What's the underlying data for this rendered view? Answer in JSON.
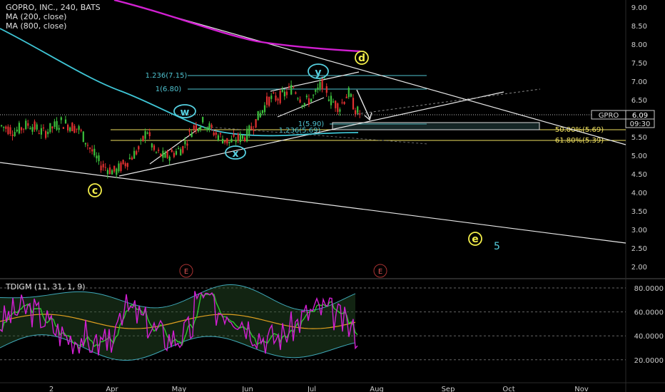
{
  "symbol_header": "GOPRO, INC., 240, BATS",
  "indicators": [
    "MA (200, close)",
    "MA (800, close)"
  ],
  "oscillator_label": "TDIGM (11, 31, 1, 9)",
  "price_axis": [
    "9.00",
    "8.50",
    "8.00",
    "7.50",
    "7.00",
    "6.50",
    "6.00",
    "5.50",
    "5.00",
    "4.50",
    "4.00",
    "3.50",
    "3.00",
    "2.50",
    "2.00"
  ],
  "osc_axis": [
    "80.0000",
    "60.0000",
    "40.0000",
    "20.0000"
  ],
  "time_axis": [
    "2",
    "Apr",
    "May",
    "Jun",
    "Jul",
    "Aug",
    "Sep",
    "Oct",
    "Nov"
  ],
  "price_badge": {
    "ticker": "GPRO",
    "price": "6.09",
    "countdown": "09:30"
  },
  "wave_labels": [
    "c",
    "w",
    "x",
    "y",
    "d",
    "e"
  ],
  "wave_count": "5",
  "earnings_marker": "E",
  "fib_labels": {
    "top_1236": "1.236(7.15)",
    "top_1": "1(6.80)",
    "mid_1": "1(5.90)",
    "mid_1236": "1.236(5.69)",
    "ret_50": "50.00%(5.69)",
    "ret_618": "61.80%(5.39)"
  },
  "colors": {
    "up": "#3cbf3c",
    "down": "#e03030",
    "ma200": "#3fc6d6",
    "ma800": "#d21fd2",
    "fib_cyan": "#4fc3d0",
    "fib_yellow": "#f0e060",
    "wave_yellow": "#f3ee4a",
    "wave_cyan": "#56d0e0"
  }
}
